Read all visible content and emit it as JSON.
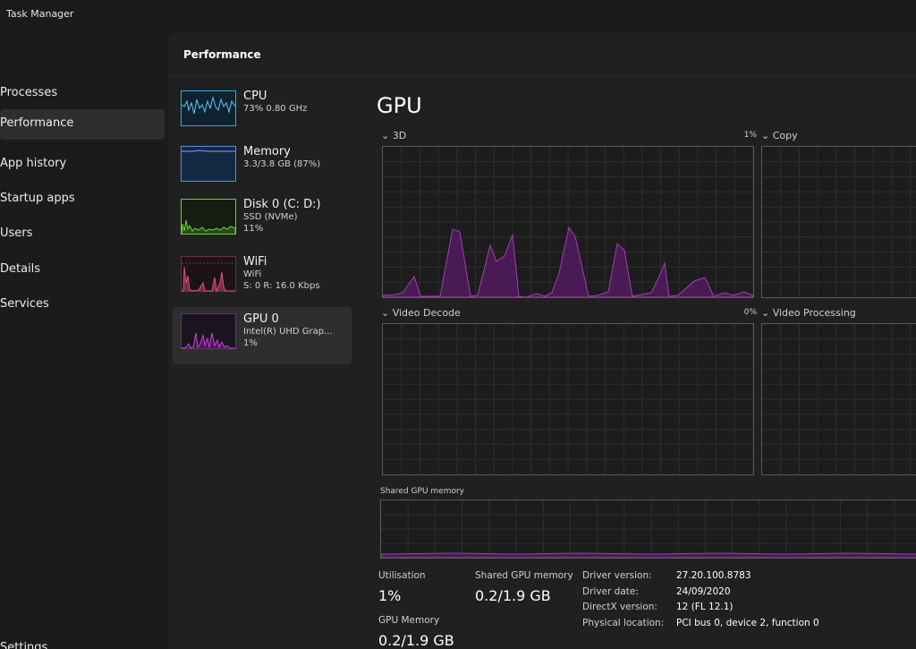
{
  "window": {
    "title": "Task Manager"
  },
  "nav": {
    "items": [
      {
        "label": "Processes"
      },
      {
        "label": "Performance"
      },
      {
        "label": "App history"
      },
      {
        "label": "Startup apps"
      },
      {
        "label": "Users"
      },
      {
        "label": "Details"
      },
      {
        "label": "Services"
      }
    ],
    "active": "Performance",
    "settings": "Settings"
  },
  "page": {
    "title": "Performance"
  },
  "devices": [
    {
      "name": "CPU",
      "line1": "73%  0.80 GHz",
      "line2": "",
      "color": "#33aadd"
    },
    {
      "name": "Memory",
      "line1": "3.3/3.8 GB (87%)",
      "line2": "",
      "color": "#5b8ddf"
    },
    {
      "name": "Disk 0 (C: D:)",
      "line1": "SSD (NVMe)",
      "line2": "11%",
      "color": "#6ad13a"
    },
    {
      "name": "WiFi",
      "line1": "WiFi",
      "line2": "S: 0  R: 16.0 Kbps",
      "color": "#e0507a"
    },
    {
      "name": "GPU 0",
      "line1": "Intel(R) UHD Grap...",
      "line2": "1%",
      "color": "#c640d6"
    }
  ],
  "gpu": {
    "title": "GPU",
    "engines": [
      {
        "label": "3D",
        "percent": "1%"
      },
      {
        "label": "Copy",
        "percent": ""
      },
      {
        "label": "Video Decode",
        "percent": "0%"
      },
      {
        "label": "Video Processing",
        "percent": ""
      }
    ],
    "shared_memory_label": "Shared GPU memory",
    "stats": {
      "utilisation_label": "Utilisation",
      "utilisation_value": "1%",
      "shared_label": "Shared GPU memory",
      "shared_value": "0.2/1.9 GB",
      "gpu_memory_label": "GPU Memory",
      "gpu_memory_value": "0.2/1.9 GB"
    },
    "details": [
      {
        "key": "Driver version:",
        "value": "27.20.100.8783"
      },
      {
        "key": "Driver date:",
        "value": "24/09/2020"
      },
      {
        "key": "DirectX version:",
        "value": "12 (FL 12.1)"
      },
      {
        "key": "Physical location:",
        "value": "PCI bus 0, device 2, function 0"
      }
    ],
    "accent_color": "#a040b0",
    "fill_color": "#4a1a55"
  }
}
